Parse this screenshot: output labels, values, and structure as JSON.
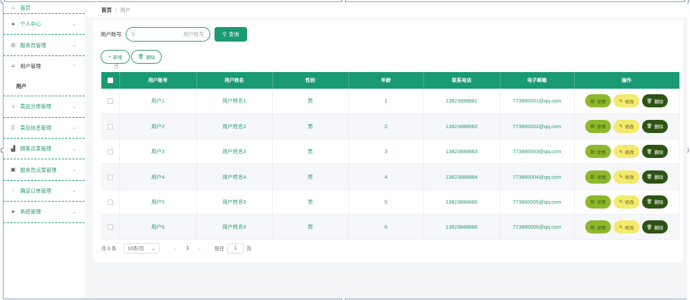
{
  "sidebar": {
    "items": [
      {
        "label": "首页",
        "icon": "home-icon",
        "glyph": "⌂",
        "chevron": ""
      },
      {
        "label": "个人中心",
        "icon": "user-icon",
        "glyph": "●",
        "chevron": "⌄"
      },
      {
        "label": "服务员管理",
        "icon": "globe-icon",
        "glyph": "◎",
        "chevron": "⌄"
      },
      {
        "label": "用户管理",
        "icon": "list-icon",
        "glyph": "≡",
        "chevron": "⌃"
      },
      {
        "label": "菜品分类管理",
        "icon": "mic-icon",
        "glyph": "♁",
        "chevron": "⌄"
      },
      {
        "label": "菜品信息管理",
        "icon": "phone-icon",
        "glyph": "▯",
        "chevron": "⌄"
      },
      {
        "label": "顾客点菜管理",
        "icon": "chart-icon",
        "glyph": "▟",
        "chevron": "⌄"
      },
      {
        "label": "服务员点菜管理",
        "icon": "briefcase-icon",
        "glyph": "▣",
        "chevron": "⌄"
      },
      {
        "label": "确定订单管理",
        "icon": "dial-icon",
        "glyph": "◌",
        "chevron": "⌄"
      },
      {
        "label": "系统管理",
        "icon": "send-icon",
        "glyph": "➤",
        "chevron": "⌄"
      }
    ],
    "sub_item": "用户"
  },
  "breadcrumb": {
    "home": "首页",
    "sep": "/",
    "current": "用户"
  },
  "search": {
    "label": "用户账号",
    "placeholder": "用户账号",
    "query_label": "查询"
  },
  "actions": {
    "add_label": "新增",
    "delete_label": "删除"
  },
  "table": {
    "headers": [
      "用户账号",
      "用户姓名",
      "性别",
      "年龄",
      "联系电话",
      "电子邮箱",
      "操作"
    ],
    "rows": [
      {
        "account": "用户1",
        "name": "用户姓名1",
        "gender": "男",
        "age": "1",
        "phone": "13823888881",
        "email": "773890001@qq.com"
      },
      {
        "account": "用户2",
        "name": "用户姓名2",
        "gender": "男",
        "age": "2",
        "phone": "13823888882",
        "email": "773890002@qq.com"
      },
      {
        "account": "用户3",
        "name": "用户姓名3",
        "gender": "男",
        "age": "3",
        "phone": "13823888883",
        "email": "773890003@qq.com"
      },
      {
        "account": "用户4",
        "name": "用户姓名4",
        "gender": "男",
        "age": "4",
        "phone": "13823888884",
        "email": "773890004@qq.com"
      },
      {
        "account": "用户5",
        "name": "用户姓名5",
        "gender": "男",
        "age": "5",
        "phone": "13823888885",
        "email": "773890005@qq.com"
      },
      {
        "account": "用户6",
        "name": "用户姓名6",
        "gender": "男",
        "age": "6",
        "phone": "13823888886",
        "email": "773890006@qq.com"
      }
    ],
    "op_detail": "详情",
    "op_edit": "修改",
    "op_delete": "删除"
  },
  "pager": {
    "total": "共 6 条",
    "page_size": "10条/页",
    "current": "1",
    "goto_label": "前往",
    "goto_value": "1",
    "page_suffix": "页"
  },
  "colors": {
    "primary": "#1a9a72",
    "detail": "#8fb72b",
    "edit": "#f3ea6e",
    "delete": "#2e5414"
  }
}
